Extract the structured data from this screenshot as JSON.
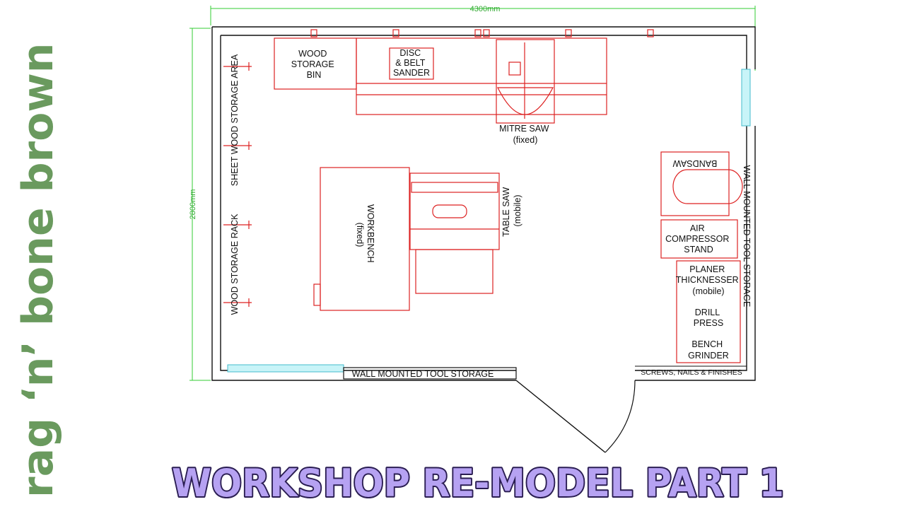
{
  "brand": {
    "text": "rag ‘n’ bone brown",
    "color": "#6a9a5e"
  },
  "title": {
    "text": "WORKSHOP RE-MODEL PART 1",
    "fill": "#b6a2f2",
    "outline": "#2a1d52"
  },
  "dimensions": {
    "width": "4300mm",
    "height": "2800mm"
  },
  "labels": {
    "wood_storage_bin": [
      "WOOD",
      "STORAGE",
      "BIN"
    ],
    "disc_belt_sander": [
      "DISC",
      "& BELT",
      "SANDER"
    ],
    "mitre_saw": [
      "MITRE SAW",
      "(fixed)"
    ],
    "bandsaw": "BANDSAW",
    "workbench": [
      "WORKBENCH",
      "(fixed)"
    ],
    "table_saw": [
      "TABLE SAW",
      "(mobile)"
    ],
    "air_compressor": [
      "AIR",
      "COMPRESSOR",
      "STAND"
    ],
    "planer": [
      "PLANER",
      "THICKNESSER",
      "(mobile)"
    ],
    "drill_press": [
      "DRILL",
      "PRESS"
    ],
    "bench_grinder": [
      "BENCH",
      "GRINDER"
    ],
    "wood_storage_rack": "WOOD  STORAGE  RACK",
    "sheet_wood_storage": "SHEET  WOOD  STORAGE  AREA",
    "wall_tool_storage_right": "WALL  MOUNTED  TOOL  STORAGE",
    "wall_tool_storage_bottom": "WALL  MOUNTED  TOOL  STORAGE",
    "screws_nails": "SCREWS, NAILS & FINISHES"
  }
}
